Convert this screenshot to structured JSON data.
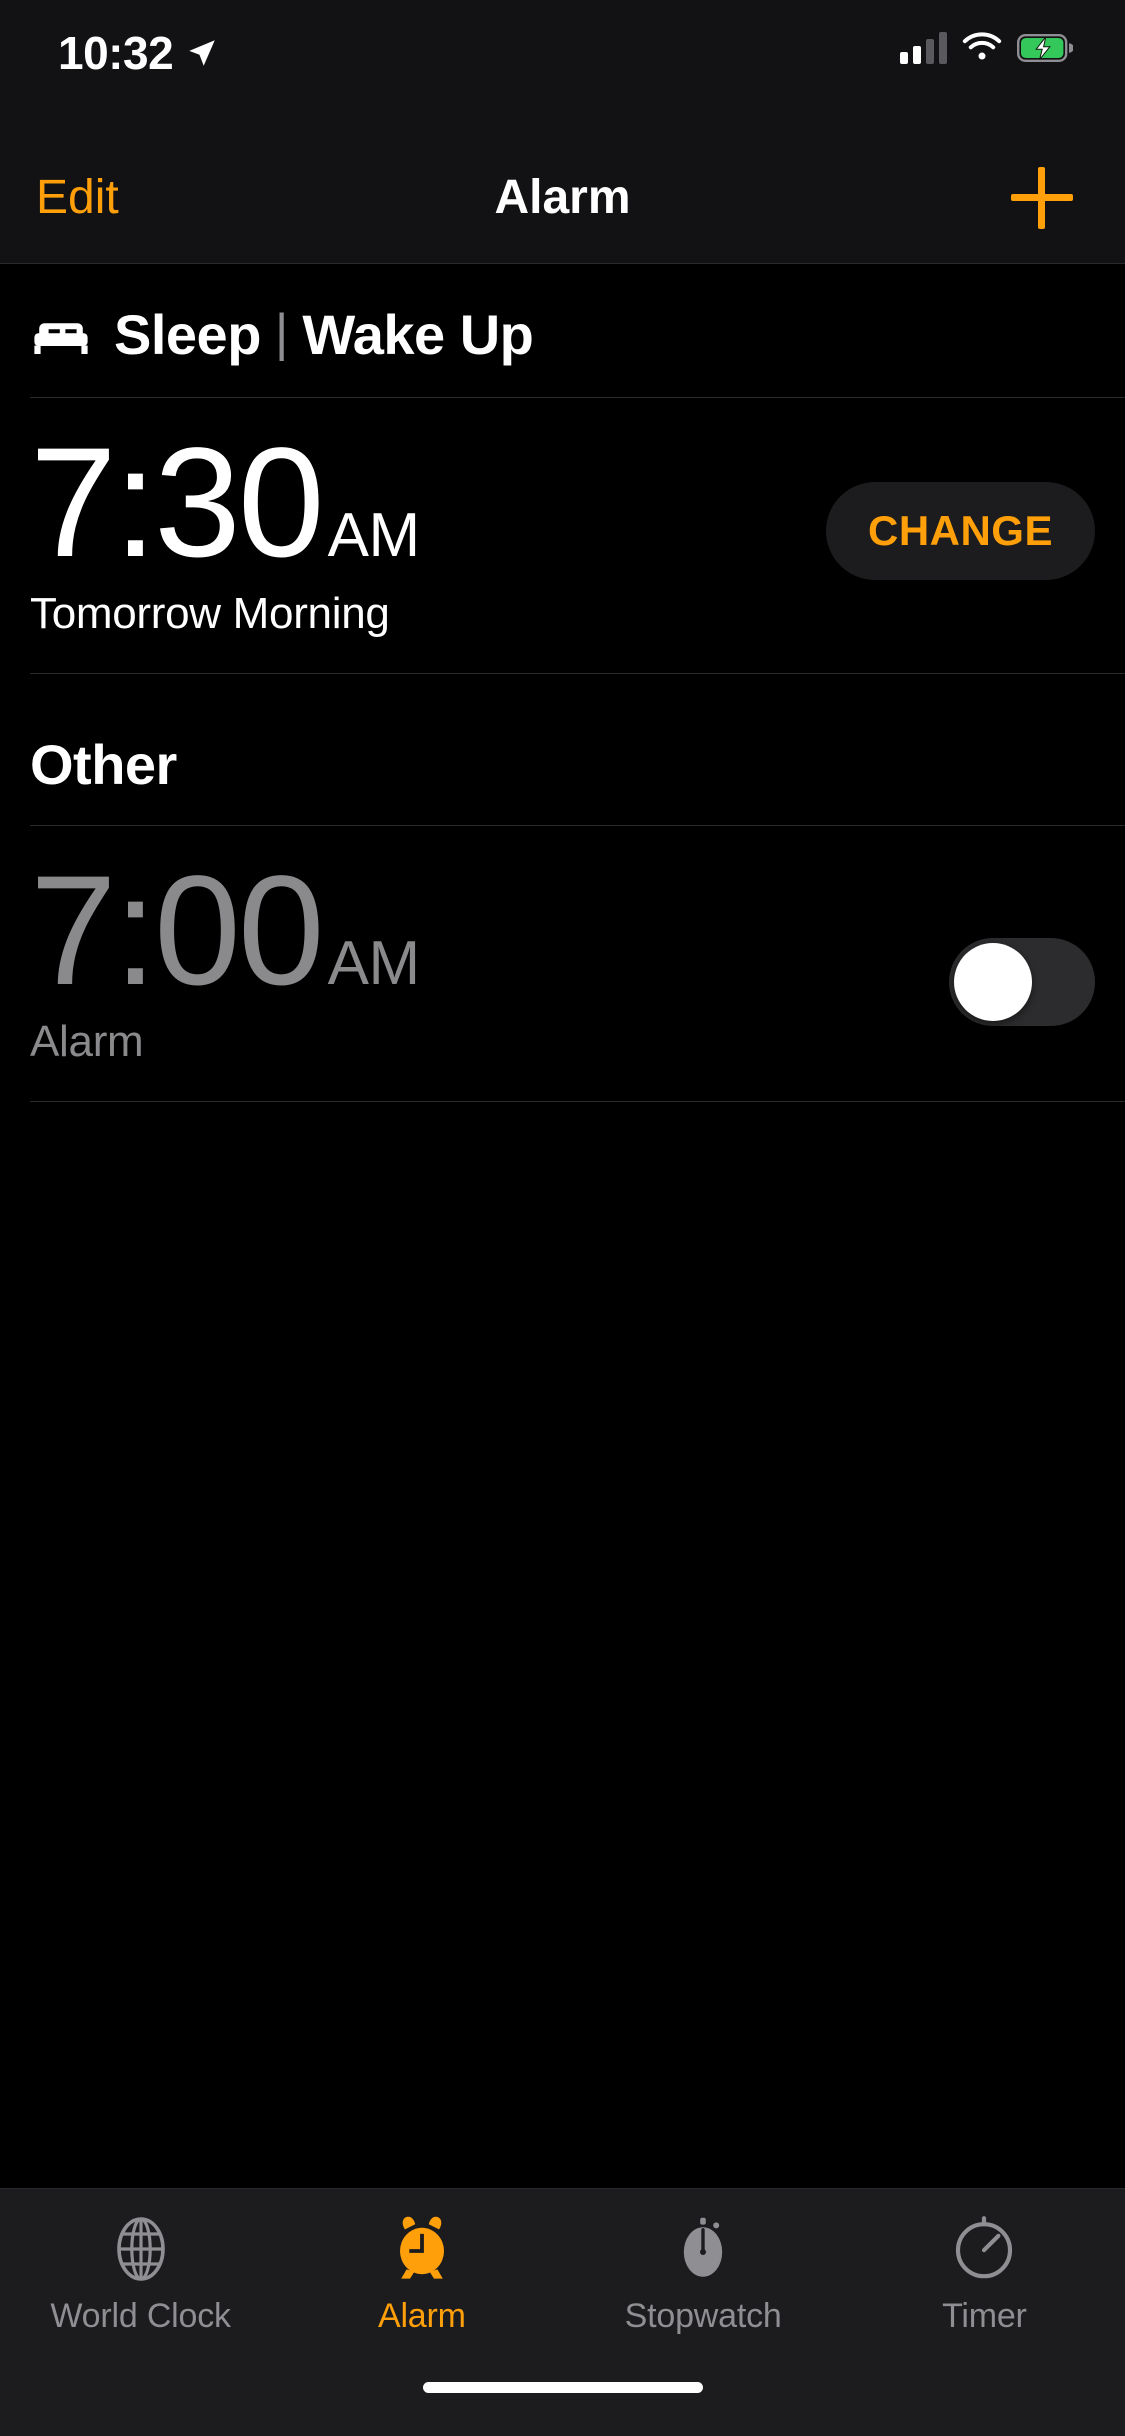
{
  "status_bar": {
    "time": "10:32",
    "location_icon": "location-arrow-icon",
    "cellular_icon": "cellular-signal-icon",
    "signal_bars_filled": 2,
    "signal_bars_total": 4,
    "wifi_icon": "wifi-icon",
    "battery_icon": "battery-charging-icon",
    "battery_charging": true,
    "battery_color": "#34C759"
  },
  "nav_bar": {
    "edit_label": "Edit",
    "title": "Alarm",
    "add_icon": "plus-icon",
    "accent_color": "#FF9F0A"
  },
  "sleep_section": {
    "bed_icon": "bed-icon",
    "sleep_label": "Sleep",
    "separator": "|",
    "wake_label": "Wake Up",
    "alarm": {
      "time": "7:30",
      "meridiem": "AM",
      "subtitle": "Tomorrow Morning",
      "change_label": "CHANGE",
      "enabled": true
    }
  },
  "other_section": {
    "label": "Other",
    "alarms": [
      {
        "time": "7:00",
        "meridiem": "AM",
        "subtitle": "Alarm",
        "enabled": false
      }
    ]
  },
  "tab_bar": {
    "active_index": 1,
    "tabs": [
      {
        "label": "World Clock",
        "icon": "globe-icon"
      },
      {
        "label": "Alarm",
        "icon": "alarm-clock-icon"
      },
      {
        "label": "Stopwatch",
        "icon": "stopwatch-icon"
      },
      {
        "label": "Timer",
        "icon": "timer-icon"
      }
    ]
  },
  "home_indicator": "home-indicator-bar"
}
